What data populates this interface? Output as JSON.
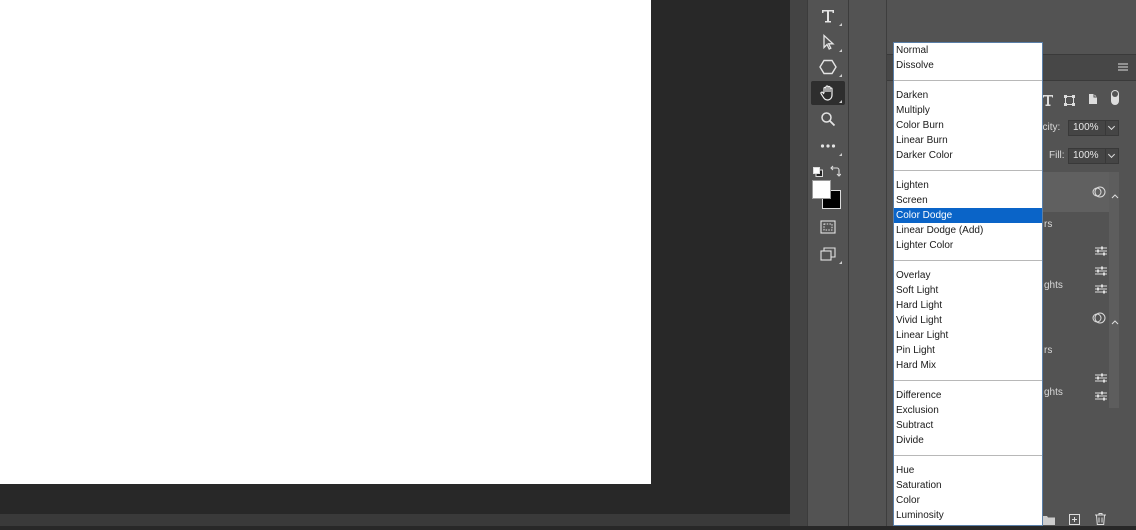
{
  "blend_modes": {
    "selected": "Color Dodge",
    "groups": [
      [
        "Normal",
        "Dissolve"
      ],
      [
        "Darken",
        "Multiply",
        "Color Burn",
        "Linear Burn",
        "Darker Color"
      ],
      [
        "Lighten",
        "Screen",
        "Color Dodge",
        "Linear Dodge (Add)",
        "Lighter Color"
      ],
      [
        "Overlay",
        "Soft Light",
        "Hard Light",
        "Vivid Light",
        "Linear Light",
        "Pin Light",
        "Hard Mix"
      ],
      [
        "Difference",
        "Exclusion",
        "Subtract",
        "Divide"
      ],
      [
        "Hue",
        "Saturation",
        "Color",
        "Luminosity"
      ]
    ]
  },
  "layers_panel": {
    "opacity_label_partial": "acity:",
    "opacity_value": "100%",
    "fill_label": "Fill:",
    "fill_value": "100%",
    "partial_label_1": "rs",
    "partial_label_2": "ghts",
    "partial_label_3": "rs",
    "partial_label_4": "ghts"
  },
  "tools": [
    {
      "name": "type-tool",
      "icon": "type-icon"
    },
    {
      "name": "path-selection-tool",
      "icon": "arrow-icon"
    },
    {
      "name": "shape-tool",
      "icon": "hexagon-icon"
    },
    {
      "name": "hand-tool",
      "icon": "hand-icon",
      "active": true
    },
    {
      "name": "zoom-tool",
      "icon": "magnifier-icon"
    },
    {
      "name": "more-tools",
      "icon": "ellipsis-icon"
    },
    {
      "name": "quick-mask",
      "icon": "quick-mask-icon"
    },
    {
      "name": "screen-mode",
      "icon": "screen-mode-icon"
    }
  ],
  "colors": {
    "foreground": "#ffffff",
    "background": "#000000",
    "selection": "#0a64c8"
  }
}
